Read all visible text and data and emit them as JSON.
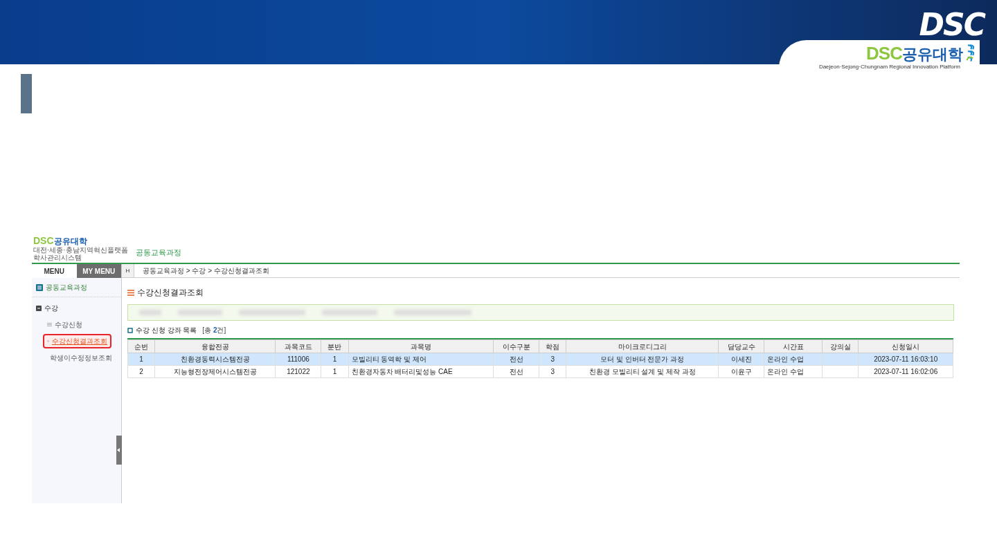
{
  "slide": {
    "banner_mark": "DSC",
    "logo": {
      "latin": "DSC",
      "korean": "공유대학",
      "tagline": "Daejeon·Sejong·Chungnam Regional Innovation Platform"
    }
  },
  "app": {
    "logo": {
      "latin": "DSC",
      "korean": "공유대학",
      "system_name": [
        "대전·세종·충남지역혁신플랫폼",
        "학사관리시스템"
      ]
    },
    "header_title": "공동교육과정",
    "tabs": [
      {
        "label": "MENU",
        "selected": true
      },
      {
        "label": "MY MENU",
        "selected": false
      }
    ],
    "breadcrumb": {
      "home": "H",
      "path": "공동교육과정 > 수강 > 수강신청결과조회"
    },
    "sidebar": {
      "section": "공동교육과정",
      "groups": [
        {
          "label": "수강",
          "expanded": true,
          "children": [
            {
              "label": "수강신청",
              "selected": false
            },
            {
              "label": "수강신청결과조회",
              "selected": true
            },
            {
              "label": "학생이수정정보조회",
              "selected": false
            }
          ]
        }
      ]
    },
    "page_title": "수강신청결과조회",
    "list": {
      "title": "수강 신청 강좌 목록",
      "count": {
        "before": "[총 ",
        "number": "2",
        "after": "건]"
      }
    },
    "table": {
      "columns": [
        "순번",
        "융합전공",
        "과목코드",
        "분반",
        "과목명",
        "이수구분",
        "학점",
        "마이크로디그리",
        "담당교수",
        "시간표",
        "강의실",
        "신청일시"
      ],
      "rows": [
        {
          "selected": true,
          "cells": [
            "1",
            "친환경동력시스템전공",
            "111006",
            "1",
            "모빌리티 동역학 및 제어",
            "전선",
            "3",
            "모터 및 인버터 전문가 과정",
            "이세진",
            "온라인 수업",
            "",
            "2023-07-11 16:03:10"
          ]
        },
        {
          "selected": false,
          "cells": [
            "2",
            "지능형전장제어시스템전공",
            "121022",
            "1",
            "친환경자동차 배터리및성능 CAE",
            "전선",
            "3",
            "친환경 모빌리티 설계 및 제작 과정",
            "이윤구",
            "온라인 수업",
            "",
            "2023-07-11 16:02:06"
          ]
        }
      ]
    }
  }
}
